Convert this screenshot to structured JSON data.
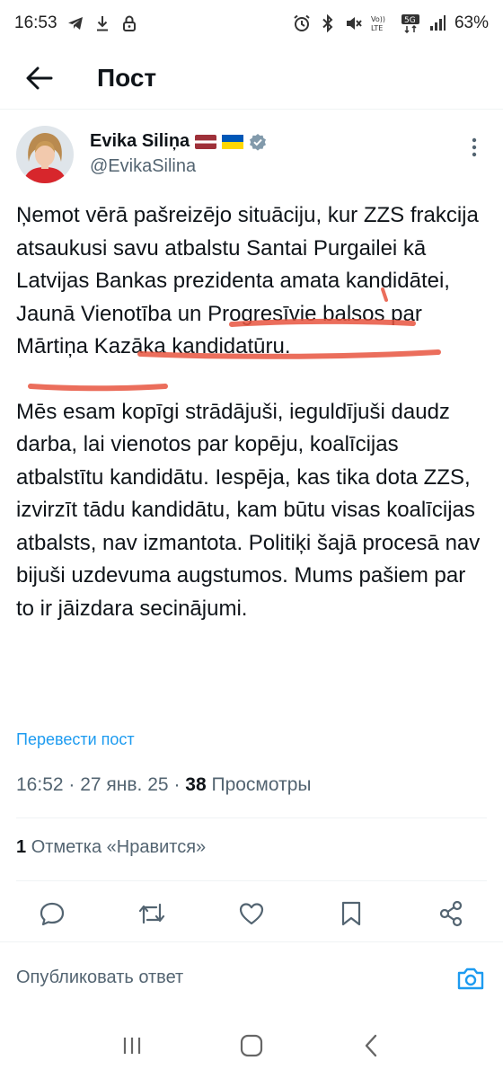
{
  "status_bar": {
    "time": "16:53",
    "battery": "63%",
    "network": "5G"
  },
  "header": {
    "title": "Пост"
  },
  "author": {
    "name": "Evika Siliņa",
    "handle": "@EvikaSilina",
    "flags": [
      "latvia-flag",
      "ukraine-flag"
    ]
  },
  "tweet": {
    "paragraph1": "Ņemot vērā pašreizējo situāciju, kur ZZS frakcija atsaukusi savu atbalstu Santai Purgailei kā Latvijas Bankas prezidenta amata kandidātei, Jaunā Vienotība un Progresīvie balsos par Mārtiņa Kazāka kandidatūru.",
    "paragraph2": "Mēs esam kopīgi strādājuši, ieguldījuši daudz darba, lai vienotos par kopēju, koalīcijas atbalstītu kandidātu. Iespēja, kas tika dota ZZS, izvirzīt tādu kandidātu, kam būtu visas koalīcijas atbalsts, nav izmantota. Politiķi šajā procesā nav bijuši uzdevuma augstumos. Mums pašiem par to ir jāizdara secinājumi.",
    "translate": "Перевести пост"
  },
  "meta": {
    "time": "16:52",
    "date": "27 янв. 25",
    "views_count": "38",
    "views_label": "Просмотры"
  },
  "likes": {
    "count": "1",
    "label": "Отметка «Нравится»"
  },
  "reply": {
    "placeholder": "Опубликовать ответ"
  },
  "colors": {
    "accent": "#1d9bf0",
    "marker": "#e8553f",
    "text": "#0f1419",
    "secondary": "#536471"
  }
}
